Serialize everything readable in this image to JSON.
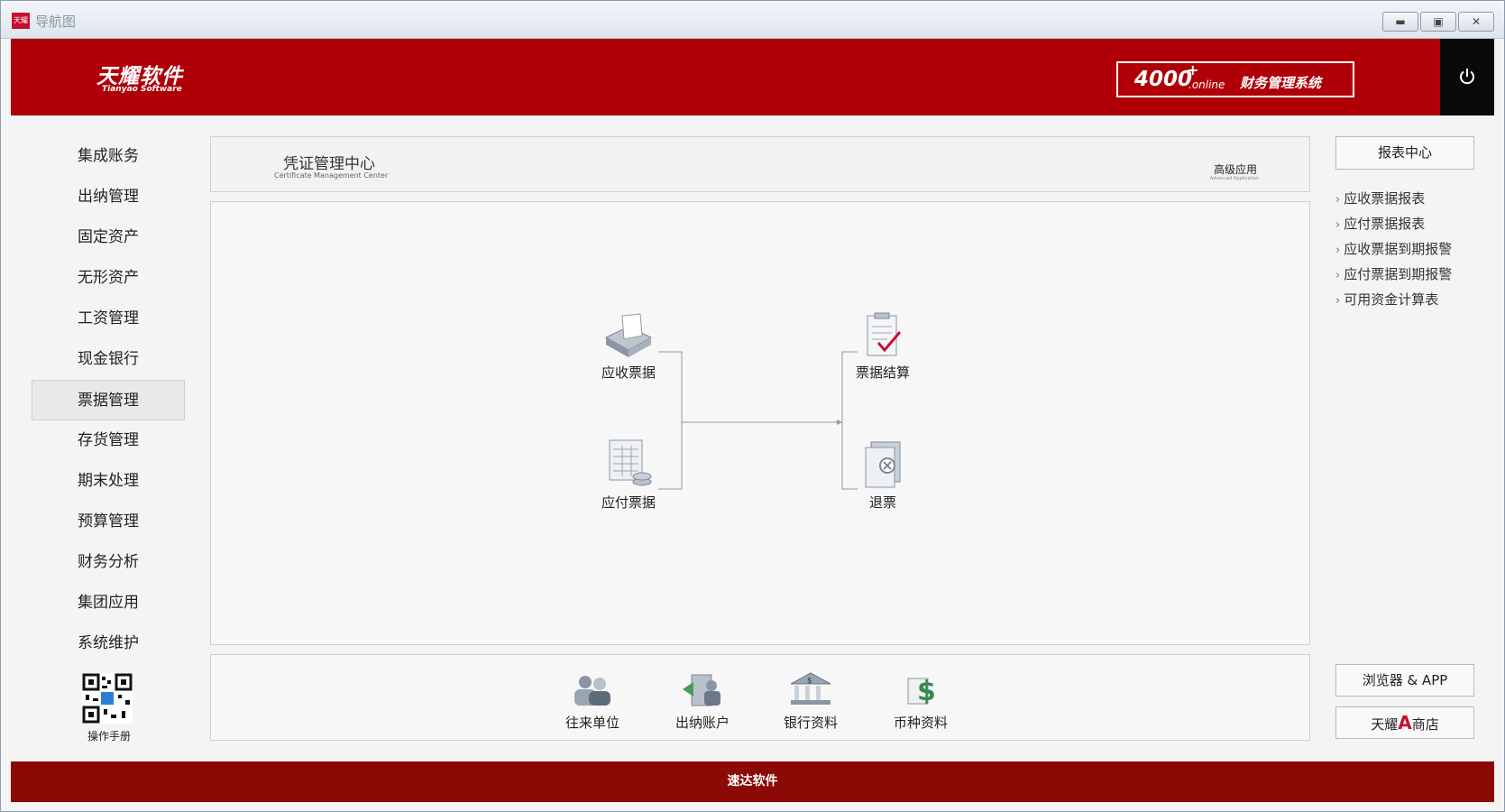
{
  "window": {
    "title": "导航图",
    "app_icon_text": "天耀"
  },
  "header": {
    "logo_cn": "天耀软件",
    "logo_en": "Tianyao Software",
    "product_number": "4000",
    "product_sup": "+",
    "product_online": ".online",
    "product_name": "财务管理系统"
  },
  "sidebar": {
    "items": [
      {
        "label": "集成账务"
      },
      {
        "label": "出纳管理"
      },
      {
        "label": "固定资产"
      },
      {
        "label": "无形资产"
      },
      {
        "label": "工资管理"
      },
      {
        "label": "现金银行"
      },
      {
        "label": "票据管理"
      },
      {
        "label": "存货管理"
      },
      {
        "label": "期末处理"
      },
      {
        "label": "预算管理"
      },
      {
        "label": "财务分析"
      },
      {
        "label": "集团应用"
      },
      {
        "label": "系统维护"
      }
    ],
    "active_item": "票据管理",
    "qr_label": "操作手册"
  },
  "panel": {
    "title": "凭证管理中心",
    "subtitle": "Certificate Management Center",
    "right_label": "高级应用",
    "right_sublabel": "Advanced Application"
  },
  "flow": {
    "receivable": "应收票据",
    "payable": "应付票据",
    "settlement": "票据结算",
    "refund": "退票"
  },
  "bottom": {
    "contacts": "往来单位",
    "cashier_account": "出纳账户",
    "bank_info": "银行资料",
    "currency_info": "币种资料"
  },
  "right": {
    "report_center": "报表中心",
    "reports": [
      {
        "label": "应收票据报表"
      },
      {
        "label": "应付票据报表"
      },
      {
        "label": "应收票据到期报警"
      },
      {
        "label": "应付票据到期报警"
      },
      {
        "label": "可用资金计算表"
      }
    ],
    "browser_app": "浏览器 & APP",
    "shop_pre": "天耀",
    "shop_a": "A",
    "shop_post": "商店"
  },
  "footer": {
    "text": "速达软件"
  },
  "colors": {
    "header_red": "#af0008",
    "footer_red": "#8c0a06",
    "power_bg": "#0a0a0a"
  }
}
